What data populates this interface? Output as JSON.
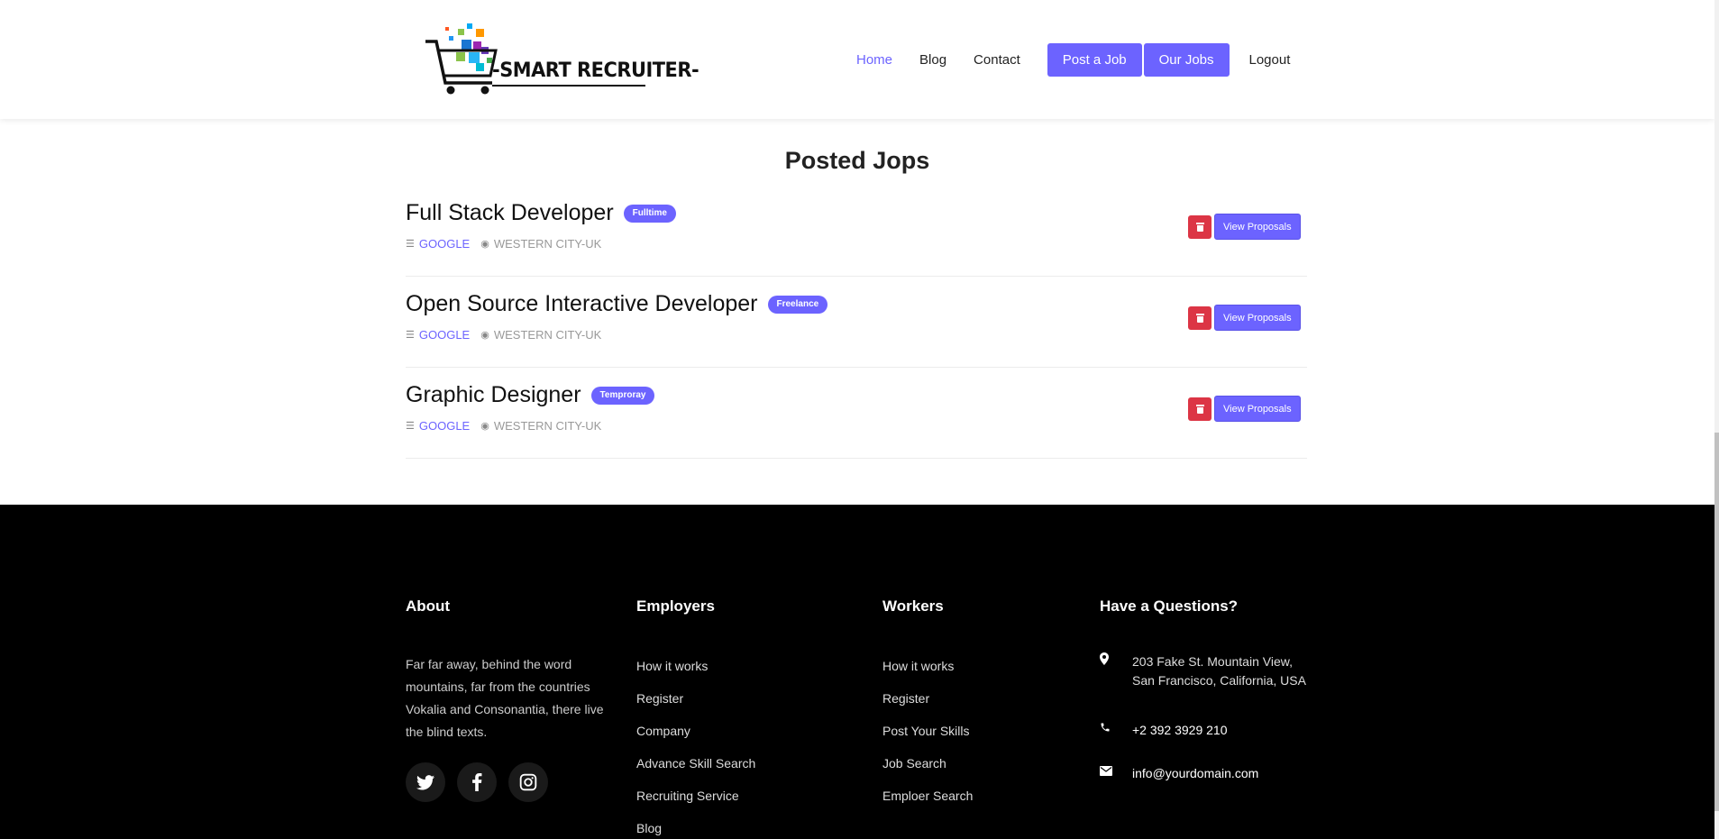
{
  "header": {
    "logo_text": "-SMART RECRUITER-",
    "nav": [
      {
        "label": "Home",
        "active": true
      },
      {
        "label": "Blog"
      },
      {
        "label": "Contact"
      }
    ],
    "post_job": "Post a Job",
    "our_jobs": "Our Jobs",
    "logout": "Logout",
    "accent": "#6c63ff"
  },
  "main": {
    "title": "Posted Jops",
    "jobs": [
      {
        "title": "Full Stack Developer",
        "badge": "Fulltime",
        "company": "GOOGLE",
        "location": "WESTERN CITY-UK",
        "view": "View Proposals"
      },
      {
        "title": "Open Source Interactive Developer",
        "badge": "Freelance",
        "company": "GOOGLE",
        "location": "WESTERN CITY-UK",
        "view": "View Proposals"
      },
      {
        "title": "Graphic Designer",
        "badge": "Temproray",
        "company": "GOOGLE",
        "location": "WESTERN CITY-UK",
        "view": "View Proposals"
      }
    ],
    "delete_color": "#dc3545"
  },
  "footer": {
    "about": {
      "heading": "About",
      "text": "Far far away, behind the word mountains, far from the countries Vokalia and Consonantia, there live the blind texts."
    },
    "employers": {
      "heading": "Employers",
      "links": [
        "How it works",
        "Register",
        "Company",
        "Advance Skill Search",
        "Recruiting Service",
        "Blog"
      ]
    },
    "workers": {
      "heading": "Workers",
      "links": [
        "How it works",
        "Register",
        "Post Your Skills",
        "Job Search",
        "Emploer Search"
      ]
    },
    "questions": {
      "heading": "Have a Questions?",
      "address": "203 Fake St. Mountain View, San Francisco, California, USA",
      "phone": "+2 392 3929 210",
      "email": "info@yourdomain.com"
    },
    "social_icons": [
      "twitter-icon",
      "facebook-icon",
      "instagram-icon"
    ]
  }
}
